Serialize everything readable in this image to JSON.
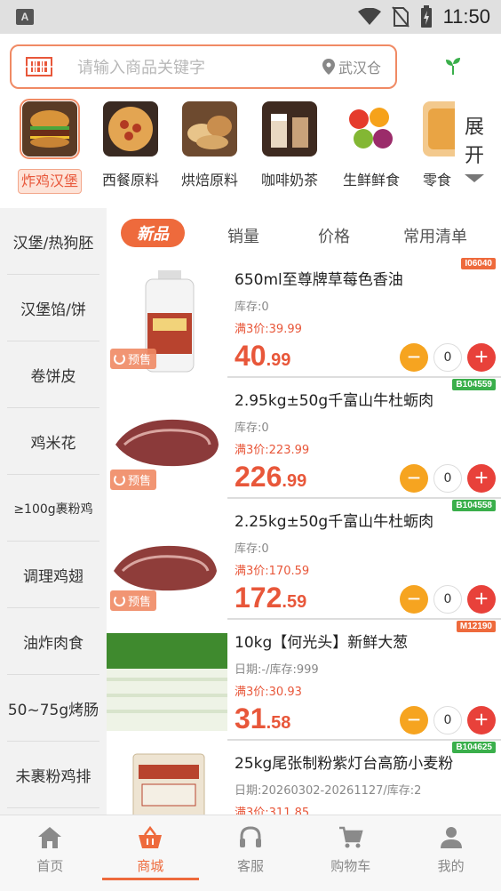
{
  "status_bar": {
    "time": "11:50",
    "app_icon_letter": "A"
  },
  "search": {
    "placeholder": "请输入商品关键字",
    "location": "武汉仓"
  },
  "colors": {
    "accent": "#ee6a3c",
    "minus": "#f6a420",
    "plus": "#e8413a",
    "promo": "#e8573a"
  },
  "categories": [
    {
      "label": "炸鸡汉堡",
      "icon": "burger-image",
      "active": true
    },
    {
      "label": "西餐原料",
      "icon": "pasta-image"
    },
    {
      "label": "烘焙原料",
      "icon": "bread-image"
    },
    {
      "label": "咖啡奶茶",
      "icon": "coffee-image"
    },
    {
      "label": "生鲜鲜食",
      "icon": "fruit-image"
    },
    {
      "label": "零食",
      "icon": "snack-image"
    }
  ],
  "expand": {
    "line1": "展",
    "line2": "开"
  },
  "sidebar": {
    "items": [
      {
        "label": "汉堡/热狗胚"
      },
      {
        "label": "汉堡馅/饼"
      },
      {
        "label": "卷饼皮"
      },
      {
        "label": "鸡米花"
      },
      {
        "label": "≥100g裹粉鸡"
      },
      {
        "label": "调理鸡翅"
      },
      {
        "label": "油炸肉食"
      },
      {
        "label": "50~75g烤肠"
      },
      {
        "label": "未裹粉鸡排"
      }
    ]
  },
  "sort_tabs": [
    {
      "label": "新品",
      "active": true
    },
    {
      "label": "销量"
    },
    {
      "label": "价格"
    },
    {
      "label": "常用清单"
    }
  ],
  "products": [
    {
      "code": "I06040",
      "code_color": "orange",
      "name": "650ml至尊牌草莓色香油",
      "stock": "库存:0",
      "promo": "满3价:39.99",
      "price_int": "40",
      "price_dec": ".99",
      "qty": "0",
      "presale": "预售",
      "image": "bottle"
    },
    {
      "code": "B104559",
      "code_color": "green",
      "name": "2.95kg±50g千富山牛杜蛎肉",
      "stock": "库存:0",
      "promo": "满3价:223.99",
      "price_int": "226",
      "price_dec": ".99",
      "qty": "0",
      "presale": "预售",
      "image": "beef"
    },
    {
      "code": "B104558",
      "code_color": "green",
      "name": "2.25kg±50g千富山牛杜蛎肉",
      "stock": "库存:0",
      "promo": "满3价:170.59",
      "price_int": "172",
      "price_dec": ".59",
      "qty": "0",
      "presale": "预售",
      "image": "beef"
    },
    {
      "code": "M12190",
      "code_color": "orange",
      "name": "10kg【何光头】新鲜大葱",
      "stock": "日期:-/库存:999",
      "promo": "满3价:30.93",
      "price_int": "31",
      "price_dec": ".58",
      "qty": "0",
      "presale": "",
      "image": "scallion"
    },
    {
      "code": "B104625",
      "code_color": "green",
      "name": "25kg尾张制粉紫灯台高筋小麦粉",
      "stock": "日期:20260302-20261127/库存:2",
      "promo": "满3价:311.85",
      "price_int": "",
      "price_dec": "",
      "qty": "",
      "presale": "",
      "image": "flour"
    }
  ],
  "bottom_nav": [
    {
      "label": "首页",
      "icon": "home-icon"
    },
    {
      "label": "商城",
      "icon": "shop-basket-icon",
      "active": true
    },
    {
      "label": "客服",
      "icon": "headset-icon"
    },
    {
      "label": "购物车",
      "icon": "cart-icon"
    },
    {
      "label": "我的",
      "icon": "user-icon"
    }
  ]
}
